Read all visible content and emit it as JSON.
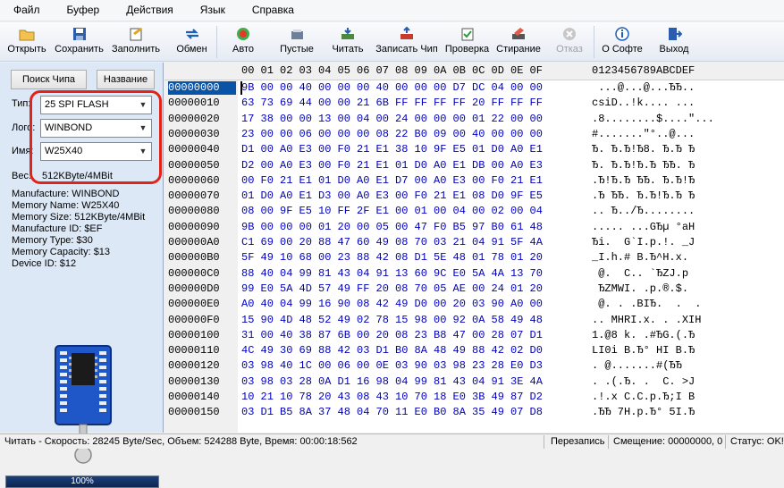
{
  "menu": [
    "Файл",
    "Буфер",
    "Действия",
    "Язык",
    "Справка"
  ],
  "toolbar": [
    {
      "label": "Открыть",
      "icon": "folder-open-icon",
      "disabled": false
    },
    {
      "label": "Сохранить",
      "icon": "save-icon",
      "disabled": false
    },
    {
      "label": "Заполнить",
      "icon": "fill-icon",
      "disabled": false
    },
    {
      "label": "Обмен",
      "icon": "swap-icon",
      "disabled": false
    },
    {
      "label": "Авто",
      "icon": "auto-icon",
      "disabled": false
    },
    {
      "label": "Пустые",
      "icon": "blank-check-icon",
      "disabled": false
    },
    {
      "label": "Читать",
      "icon": "read-icon",
      "disabled": false
    },
    {
      "label": "Записать Чип",
      "icon": "write-chip-icon",
      "disabled": false
    },
    {
      "label": "Проверка",
      "icon": "verify-icon",
      "disabled": false
    },
    {
      "label": "Стирание",
      "icon": "erase-icon",
      "disabled": false
    },
    {
      "label": "Отказ",
      "icon": "cancel-icon",
      "disabled": true
    },
    {
      "label": "О Софте",
      "icon": "info-icon",
      "disabled": false
    },
    {
      "label": "Выход",
      "icon": "exit-icon",
      "disabled": false
    }
  ],
  "left": {
    "search_chip": "Поиск Чипа",
    "name_btn": "Название",
    "type_label": "Тип:",
    "type_value": "25 SPI FLASH",
    "logo_label": "Лого:",
    "logo_value": "WINBOND",
    "name_label": "Имя:",
    "name_value": "W25X40",
    "size_label": "Вес:",
    "size_value": "512KByte/4MBit",
    "info": [
      "Manufacture: WINBOND",
      "Memory Name: W25X40",
      "Memory Size: 512KByte/4MBit",
      "Manufacture ID: $EF",
      "Memory Type: $30",
      "Memory Capacity: $13",
      "Device ID: $12"
    ],
    "progress": "100%"
  },
  "hex": {
    "columns": [
      "00",
      "01",
      "02",
      "03",
      "04",
      "05",
      "06",
      "07",
      "08",
      "09",
      "0A",
      "0B",
      "0C",
      "0D",
      "0E",
      "0F"
    ],
    "ascii_header": "0123456789ABCDEF",
    "rows": [
      {
        "addr": "00000000",
        "bytes": "9B 00 00 40 00 00 00 40 00 00 00 D7 DC 04 00 00",
        "ascii": " ...@...@...ЂЂ.."
      },
      {
        "addr": "00000010",
        "bytes": "63 73 69 44 00 00 21 6B FF FF FF FF 20 FF FF FF",
        "ascii": "csiD..!k.... ..."
      },
      {
        "addr": "00000020",
        "bytes": "17 38 00 00 13 00 04 00 24 00 00 00 01 22 00 00",
        "ascii": ".8........$....\"..."
      },
      {
        "addr": "00000030",
        "bytes": "23 00 00 06 00 00 00 08 22 B0 09 00 40 00 00 00",
        "ascii": "#.......\"°..@..."
      },
      {
        "addr": "00000040",
        "bytes": "D1 00 A0 E3 00 F0 21 E1 38 10 9F E5 01 D0 A0 E1",
        "ascii": "Ђ. Ђ.Ђ!Ђ8. Ђ.Ђ Ђ"
      },
      {
        "addr": "00000050",
        "bytes": "D2 00 A0 E3 00 F0 21 E1 01 D0 A0 E1 DB 00 A0 E3",
        "ascii": "Ђ. Ђ.Ђ!Ђ.Ђ ЂЂ. Ђ"
      },
      {
        "addr": "00000060",
        "bytes": "00 F0 21 E1 01 D0 A0 E1 D7 00 A0 E3 00 F0 21 E1",
        "ascii": ".Ђ!Ђ.Ђ ЂЂ. Ђ.Ђ!Ђ"
      },
      {
        "addr": "00000070",
        "bytes": "01 D0 A0 E1 D3 00 A0 E3 00 F0 21 E1 08 D0 9F E5",
        "ascii": ".Ђ ЂЂ. Ђ.Ђ!Ђ.Ђ Ђ"
      },
      {
        "addr": "00000080",
        "bytes": "08 00 9F E5 10 FF 2F E1 00 01 00 04 00 02 00 04",
        "ascii": ".. Ђ../Ђ........"
      },
      {
        "addr": "00000090",
        "bytes": "9B 00 00 00 01 20 00 05 00 47 F0 B5 97 B0 61 48",
        "ascii": "..... ...GЂµ °aH"
      },
      {
        "addr": "000000A0",
        "bytes": "C1 69 00 20 88 47 60 49 08 70 03 21 04 91 5F 4A",
        "ascii": "Ђi.  G`I.p.!. _J"
      },
      {
        "addr": "000000B0",
        "bytes": "5F 49 10 68 00 23 88 42 08 D1 5E 48 01 78 01 20",
        "ascii": "_I.h.# B.Ђ^H.x. "
      },
      {
        "addr": "000000C0",
        "bytes": "88 40 04 99 81 43 04 91 13 60 9C E0 5A 4A 13 70",
        "ascii": " @.  C.. `ЂZJ.p"
      },
      {
        "addr": "000000D0",
        "bytes": "99 E0 5A 4D 57 49 FF 20 08 70 05 AE 00 24 01 20",
        "ascii": " ЂZMWI. .p.®.$. "
      },
      {
        "addr": "000000E0",
        "bytes": "A0 40 04 99 16 90 08 42 49 D0 00 20 03 90 A0 00",
        "ascii": " @. . .BIЂ.  .  ."
      },
      {
        "addr": "000000F0",
        "bytes": "15 90 4D 48 52 49 02 78 15 98 00 92 0A 58 49 48",
        "ascii": ".. MHRI.x. . .XIH"
      },
      {
        "addr": "00000100",
        "bytes": "31 00 40 38 87 6B 00 20 08 23 B8 47 00 28 07 D1",
        "ascii": "1.@8 k. .#ЂG.(.Ђ"
      },
      {
        "addr": "00000110",
        "bytes": "4C 49 30 69 88 42 03 D1 B0 8A 48 49 88 42 02 D0",
        "ascii": "LI0i B.Ђ° HI B.Ђ"
      },
      {
        "addr": "00000120",
        "bytes": "03 98 40 1C 00 06 00 0E 03 90 03 98 23 28 E0 D3",
        "ascii": ". @.......#(ЂЂ"
      },
      {
        "addr": "00000130",
        "bytes": "03 98 03 28 0A D1 16 98 04 99 81 43 04 91 3E 4A",
        "ascii": ". .(.Ђ. .  C. >J"
      },
      {
        "addr": "00000140",
        "bytes": "10 21 10 78 20 43 08 43 10 70 18 E0 3B 49 87 D2",
        "ascii": ".!.x C.C.p.Ђ;I B"
      },
      {
        "addr": "00000150",
        "bytes": "03 D1 B5 8A 37 48 04 70 11 E0 B0 8A 35 49 07 D8",
        "ascii": ".ЂЂ 7H.p.Ђ° 5I.Ђ"
      }
    ]
  },
  "status": {
    "main": "Читать - Скорость: 28245 Byte/Sec, Объем: 524288 Byte, Время: 00:00:18:562",
    "mode": "Перезапись",
    "offset": "Смещение: 00000000, 0",
    "state": "Статус: OK!"
  },
  "colors": {
    "accent": "#0a54a8",
    "hex_bytes": "#0000c0",
    "highlight": "#e2231a"
  }
}
